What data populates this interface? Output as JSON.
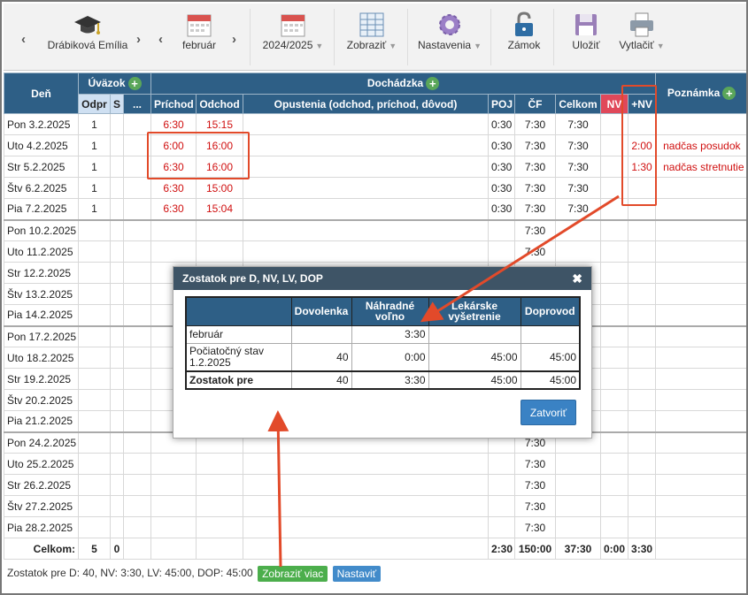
{
  "toolbar": {
    "employee": "Drábiková Emília",
    "month": "február",
    "year": "2024/2025",
    "zobrazit": "Zobraziť",
    "nastavenia": "Nastavenia",
    "zamok": "Zámok",
    "ulozit": "Uložiť",
    "vytlacit": "Vytlačiť"
  },
  "headers": {
    "den": "Deň",
    "uvazok": "Úväzok",
    "dochadzka": "Dochádzka",
    "poznamka": "Poznámka",
    "odpr": "Odpr",
    "s": "S",
    "dots": "...",
    "prichod": "Príchod",
    "odchod": "Odchod",
    "opustenia": "Opustenia (odchod, príchod, dôvod)",
    "poj": "POJ",
    "cf": "ČF",
    "celkom": "Celkom",
    "nv": "NV",
    "plusnv": "+NV"
  },
  "rows": [
    {
      "day": "Pon 3.2.2025",
      "odpr": "1",
      "prichod": "6:30",
      "odchod": "15:15",
      "poj": "0:30",
      "cf": "7:30",
      "celkom": "7:30",
      "plusnv": "",
      "note": ""
    },
    {
      "day": "Uto 4.2.2025",
      "odpr": "1",
      "prichod": "6:00",
      "odchod": "16:00",
      "poj": "0:30",
      "cf": "7:30",
      "celkom": "7:30",
      "plusnv": "2:00",
      "note": "nadčas posudok"
    },
    {
      "day": "Str 5.2.2025",
      "odpr": "1",
      "prichod": "6:30",
      "odchod": "16:00",
      "poj": "0:30",
      "cf": "7:30",
      "celkom": "7:30",
      "plusnv": "1:30",
      "note": "nadčas stretnutie"
    },
    {
      "day": "Štv 6.2.2025",
      "odpr": "1",
      "prichod": "6:30",
      "odchod": "15:00",
      "poj": "0:30",
      "cf": "7:30",
      "celkom": "7:30",
      "plusnv": "",
      "note": ""
    },
    {
      "day": "Pia 7.2.2025",
      "odpr": "1",
      "prichod": "6:30",
      "odchod": "15:04",
      "poj": "0:30",
      "cf": "7:30",
      "celkom": "7:30",
      "plusnv": "",
      "note": ""
    },
    {
      "day": "Pon 10.2.2025",
      "cf": "7:30"
    },
    {
      "day": "Uto 11.2.2025",
      "cf": "7:30"
    },
    {
      "day": "Str 12.2.2025",
      "cf": ""
    },
    {
      "day": "Štv 13.2.2025",
      "cf": ""
    },
    {
      "day": "Pia 14.2.2025",
      "cf": ""
    },
    {
      "day": "Pon 17.2.2025",
      "cf": ""
    },
    {
      "day": "Uto 18.2.2025",
      "cf": ""
    },
    {
      "day": "Str 19.2.2025",
      "cf": ""
    },
    {
      "day": "Štv 20.2.2025",
      "cf": ""
    },
    {
      "day": "Pia 21.2.2025",
      "cf": ""
    },
    {
      "day": "Pon 24.2.2025",
      "cf": "7:30"
    },
    {
      "day": "Uto 25.2.2025",
      "cf": "7:30"
    },
    {
      "day": "Str 26.2.2025",
      "cf": "7:30"
    },
    {
      "day": "Štv 27.2.2025",
      "cf": "7:30"
    },
    {
      "day": "Pia 28.2.2025",
      "cf": "7:30"
    }
  ],
  "totals": {
    "label": "Celkom:",
    "odpr": "5",
    "s": "0",
    "poj": "2:30",
    "cf": "150:00",
    "celkom": "37:30",
    "nv": "0:00",
    "plusnv": "3:30"
  },
  "footer": {
    "text": "Zostatok pre D: 40, NV: 3:30, LV: 45:00, DOP: 45:00",
    "more": "Zobraziť viac",
    "set": "Nastaviť"
  },
  "dialog": {
    "title": "Zostatok pre D, NV, LV, DOP",
    "close_label": "Zatvoriť",
    "columns": [
      "",
      "Dovolenka",
      "Náhradné voľno",
      "Lekárske vyšetrenie",
      "Doprovod"
    ],
    "rows": [
      {
        "label": "február",
        "d": "",
        "nv": "3:30",
        "lv": "",
        "dop": ""
      },
      {
        "label": "Počiatočný stav 1.2.2025",
        "d": "40",
        "nv": "0:00",
        "lv": "45:00",
        "dop": "45:00"
      },
      {
        "label": "Zostatok pre",
        "d": "40",
        "nv": "3:30",
        "lv": "45:00",
        "dop": "45:00"
      }
    ]
  },
  "colors": {
    "header_bg": "#2e5f86",
    "annotation": "#e24a2a",
    "red_text": "#d01010",
    "nv_header": "#e0485a"
  }
}
